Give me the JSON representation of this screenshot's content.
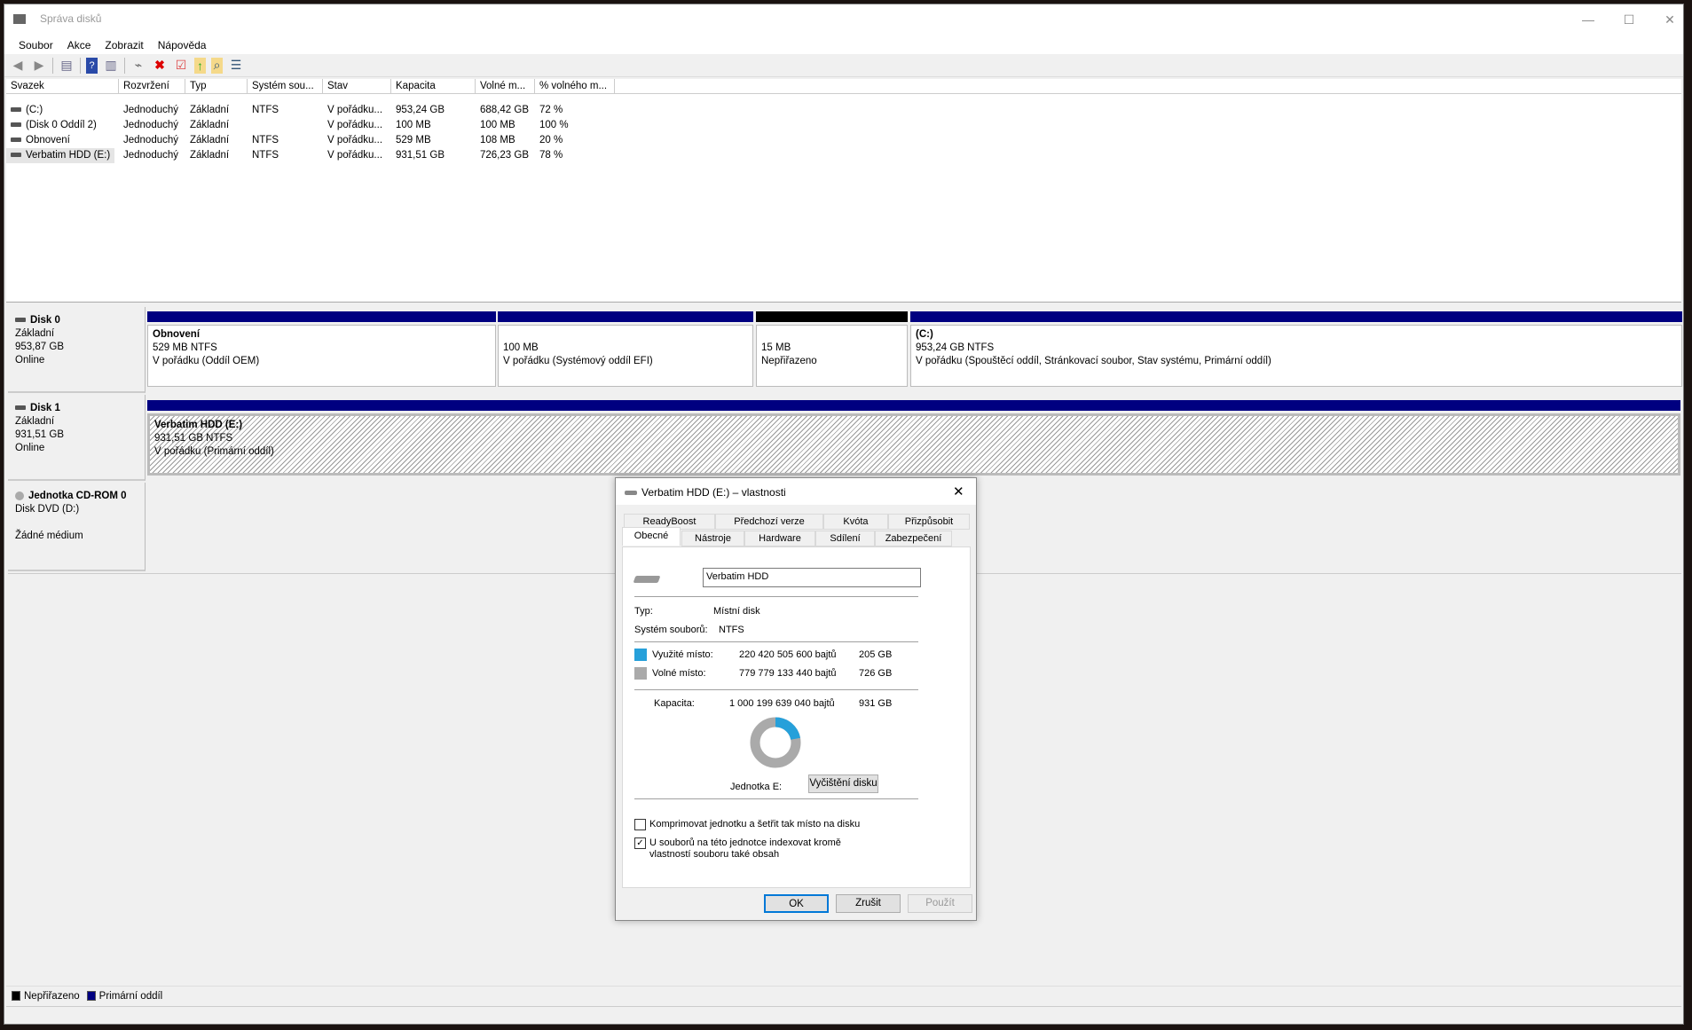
{
  "window": {
    "title": "Správa disků",
    "minimize": "—",
    "maximize": "☐",
    "close": "✕"
  },
  "menu": [
    "Soubor",
    "Akce",
    "Zobrazit",
    "Nápověda"
  ],
  "toolbar": [
    "back-icon",
    "forward-icon",
    "console-tree-icon",
    "help-icon",
    "action-pane-icon",
    "connect-icon",
    "delete-icon",
    "properties-icon",
    "folder-up-icon",
    "search-icon",
    "checklist-icon"
  ],
  "volumes": {
    "columns": [
      "Svazek",
      "Rozvržení",
      "Typ",
      "Systém sou...",
      "Stav",
      "Kapacita",
      "Volné m...",
      "% volného m..."
    ],
    "rows": [
      [
        "(C:)",
        "Jednoduchý",
        "Základní",
        "NTFS",
        "V pořádku...",
        "953,24 GB",
        "688,42 GB",
        "72 %"
      ],
      [
        "(Disk 0 Oddíl 2)",
        "Jednoduchý",
        "Základní",
        "",
        "V pořádku...",
        "100 MB",
        "100 MB",
        "100 %"
      ],
      [
        "Obnovení",
        "Jednoduchý",
        "Základní",
        "NTFS",
        "V pořádku...",
        "529 MB",
        "108 MB",
        "20 %"
      ],
      [
        "Verbatim HDD (E:)",
        "Jednoduchý",
        "Základní",
        "NTFS",
        "V pořádku...",
        "931,51 GB",
        "726,23 GB",
        "78 %"
      ]
    ]
  },
  "disks": [
    {
      "name": "Disk 0",
      "type": "Základní",
      "size": "953,87 GB",
      "status": "Online",
      "partitions": [
        {
          "title": "Obnovení",
          "size": "529 MB NTFS",
          "status": "V pořádku (Oddíl OEM)"
        },
        {
          "title": "",
          "size": "100 MB",
          "status": "V pořádku (Systémový oddíl EFI)"
        },
        {
          "title": "",
          "size": "15 MB",
          "status": "Nepřiřazeno"
        },
        {
          "title": "(C:)",
          "size": "953,24 GB NTFS",
          "status": "V pořádku (Spouštěcí oddíl, Stránkovací soubor, Stav systému, Primární oddíl)"
        }
      ]
    },
    {
      "name": "Disk 1",
      "type": "Základní",
      "size": "931,51 GB",
      "status": "Online",
      "partitions": [
        {
          "title": "Verbatim HDD  (E:)",
          "size": "931,51 GB NTFS",
          "status": "V pořádku (Primární oddíl)"
        }
      ]
    },
    {
      "name": "Jednotka CD-ROM 0",
      "type": "Disk DVD (D:)",
      "status": "Žádné médium"
    }
  ],
  "legend": [
    {
      "label": "Nepřiřazeno",
      "color": "#000000"
    },
    {
      "label": "Primární oddíl",
      "color": "#000080"
    }
  ],
  "dialog": {
    "title": "Verbatim HDD (E:) – vlastnosti",
    "close": "✕",
    "tabs_row1": [
      "ReadyBoost",
      "Předchozí verze",
      "Kvóta",
      "Přizpůsobit"
    ],
    "tabs_row2": [
      "Obecné",
      "Nástroje",
      "Hardware",
      "Sdílení",
      "Zabezpečení"
    ],
    "name_value": "Verbatim HDD",
    "type_label": "Typ:",
    "type_value": "Místní disk",
    "fs_label": "Systém souborů:",
    "fs_value": "NTFS",
    "used_label": "Využité místo:",
    "used_bytes": "220 420 505 600 bajtů",
    "used_gb": "205 GB",
    "used_color": "#26a0da",
    "free_label": "Volné místo:",
    "free_bytes": "779 779 133 440 bajtů",
    "free_gb": "726 GB",
    "free_color": "#aaaaaa",
    "cap_label": "Kapacita:",
    "cap_bytes": "1 000 199 639 040 bajtů",
    "cap_gb": "931 GB",
    "used_fraction": 0.22,
    "drive_label": "Jednotka E:",
    "cleanup": "Vyčištění disku",
    "compress": "Komprimovat jednotku a šetřit tak místo na disku",
    "compress_checked": false,
    "index": "U souborů na této jednotce indexovat kromě vlastností souboru také obsah",
    "index_checked": true,
    "ok": "OK",
    "cancel": "Zrušit",
    "apply": "Použít"
  }
}
